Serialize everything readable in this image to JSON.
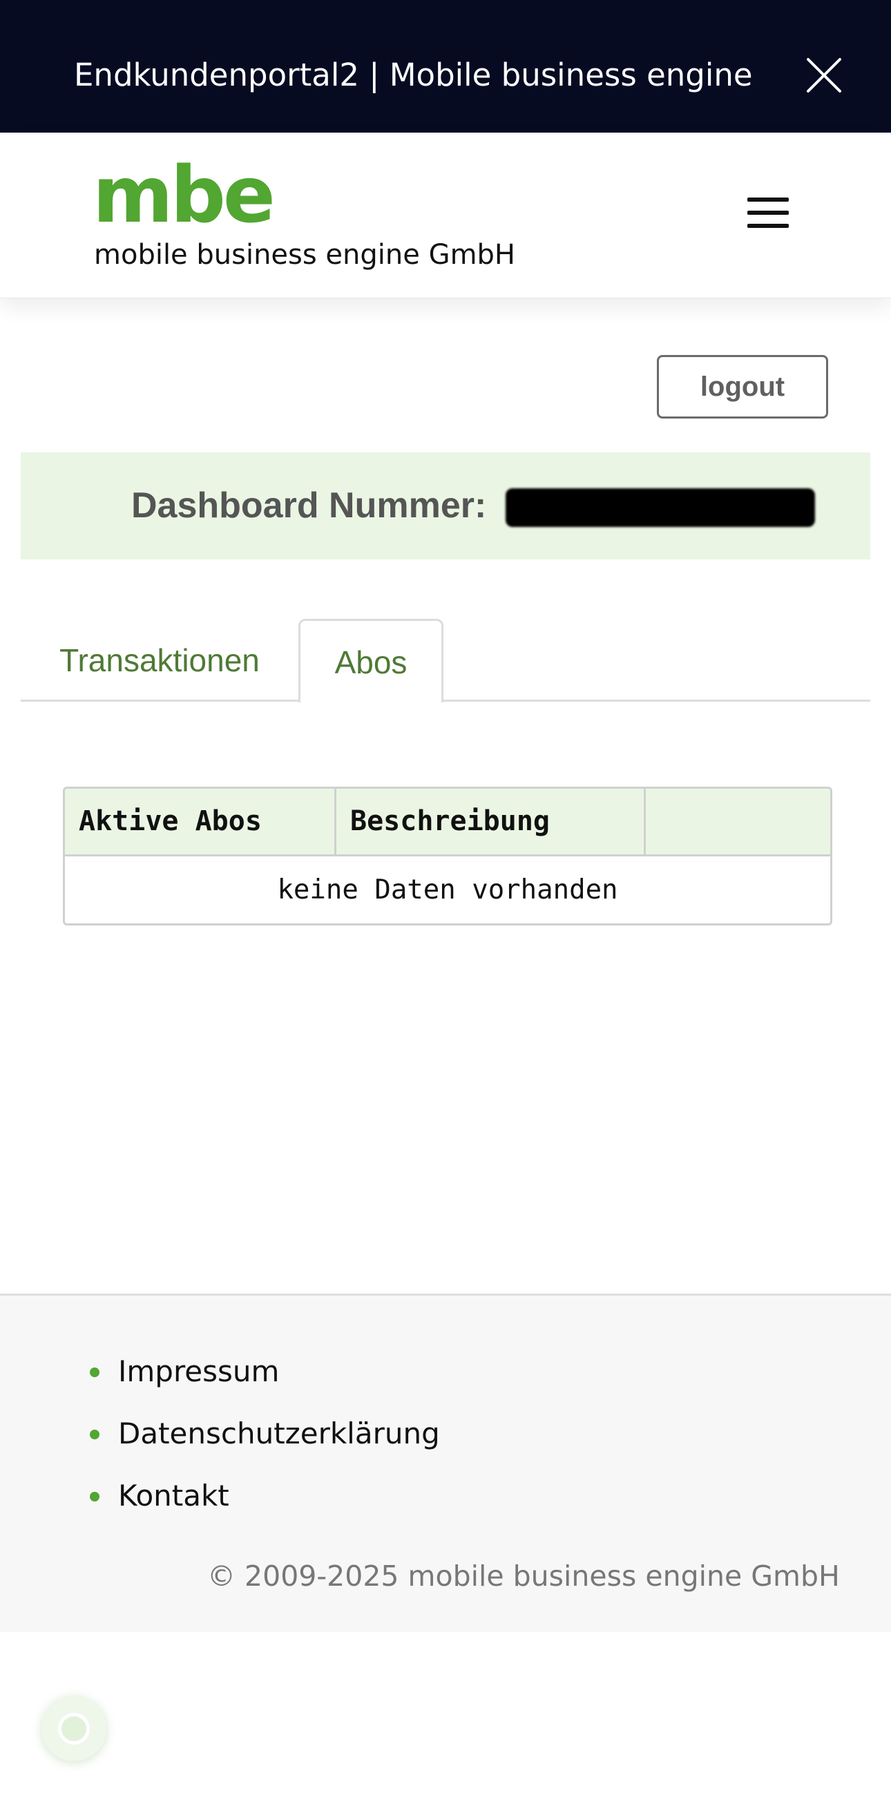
{
  "browser": {
    "title": "Endkundenportal2 | Mobile business engine"
  },
  "header": {
    "logo_text": "mbe",
    "company_name": "mobile business engine GmbH"
  },
  "account": {
    "logout_label": "logout"
  },
  "dashboard": {
    "label": "Dashboard Nummer:"
  },
  "tabs": [
    {
      "label": "Transaktionen",
      "active": false
    },
    {
      "label": "Abos",
      "active": true
    }
  ],
  "table": {
    "columns": [
      "Aktive Abos",
      "Beschreibung",
      ""
    ],
    "empty_message": "keine Daten vorhanden"
  },
  "footer": {
    "links": [
      "Impressum",
      "Datenschutzerklärung",
      "Kontakt"
    ],
    "copyright": "© 2009-2025 mobile business engine GmbH"
  },
  "colors": {
    "brand_green": "#52a632",
    "topbar_bg": "#070b22",
    "banner_bg": "#eaf6e3",
    "tab_text": "#4f7a36"
  },
  "icons": {
    "close": "close-icon",
    "menu": "hamburger-menu-icon",
    "chat": "chat-widget-icon"
  }
}
